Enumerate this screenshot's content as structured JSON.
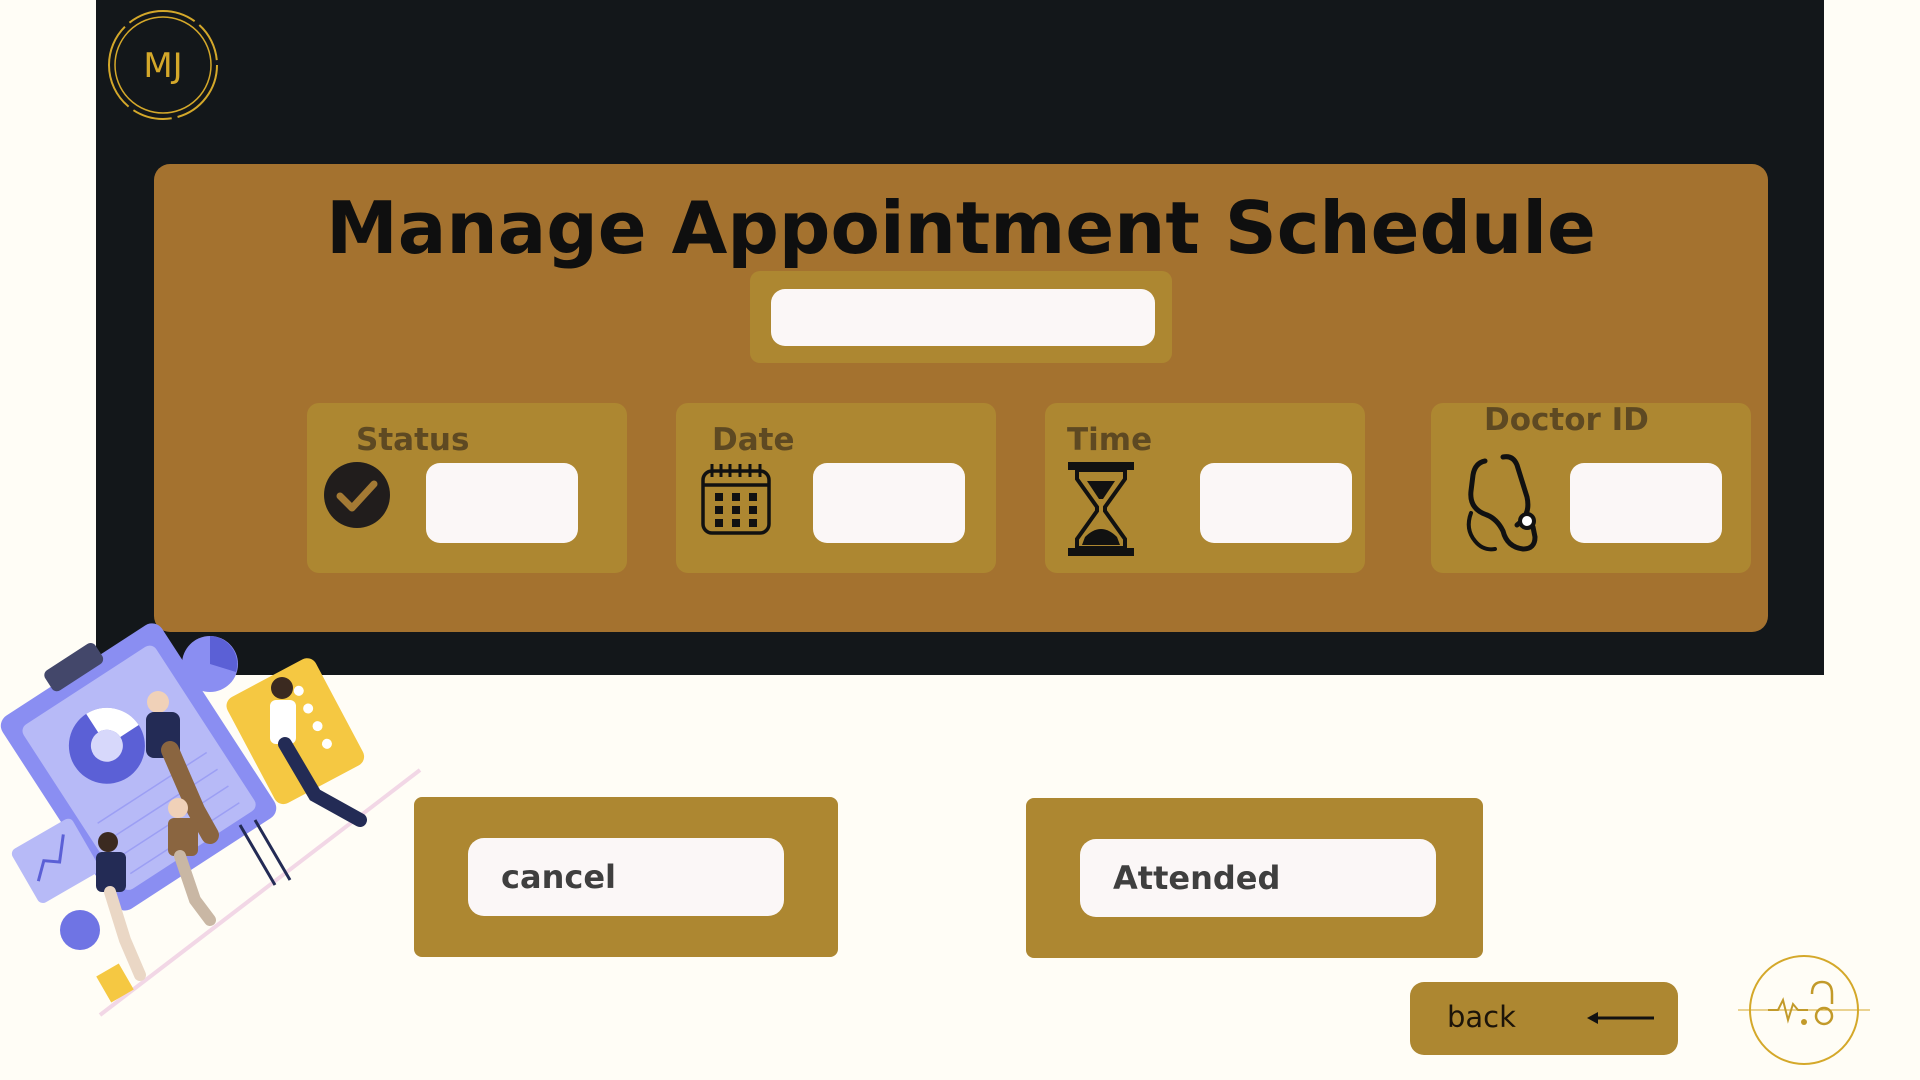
{
  "header": {
    "logo_text": "MJ",
    "logo_icon": "mj-monogram-icon"
  },
  "page": {
    "title": "Manage Appointment Schedule"
  },
  "search": {
    "value": "",
    "placeholder": ""
  },
  "fields": [
    {
      "label": "Status",
      "icon": "check-circle-icon",
      "value": ""
    },
    {
      "label": "Date",
      "icon": "calendar-icon",
      "value": ""
    },
    {
      "label": "Time",
      "icon": "hourglass-icon",
      "value": ""
    },
    {
      "label": "Doctor ID",
      "icon": "stethoscope-icon",
      "value": ""
    }
  ],
  "actions": {
    "cancel_label": "cancel",
    "attended_label": "Attended",
    "back_label": "back",
    "back_icon": "arrow-left-icon"
  },
  "footer": {
    "logo_icon": "heartbeat-stethoscope-logo-icon"
  },
  "colors": {
    "background": "#fffdf6",
    "dark_panel": "#13171a",
    "card": "#a4722f",
    "field_card": "#ad8731",
    "input": "#fbf7f7",
    "label": "#5e4922",
    "logo_gold": "#d4a82a"
  }
}
